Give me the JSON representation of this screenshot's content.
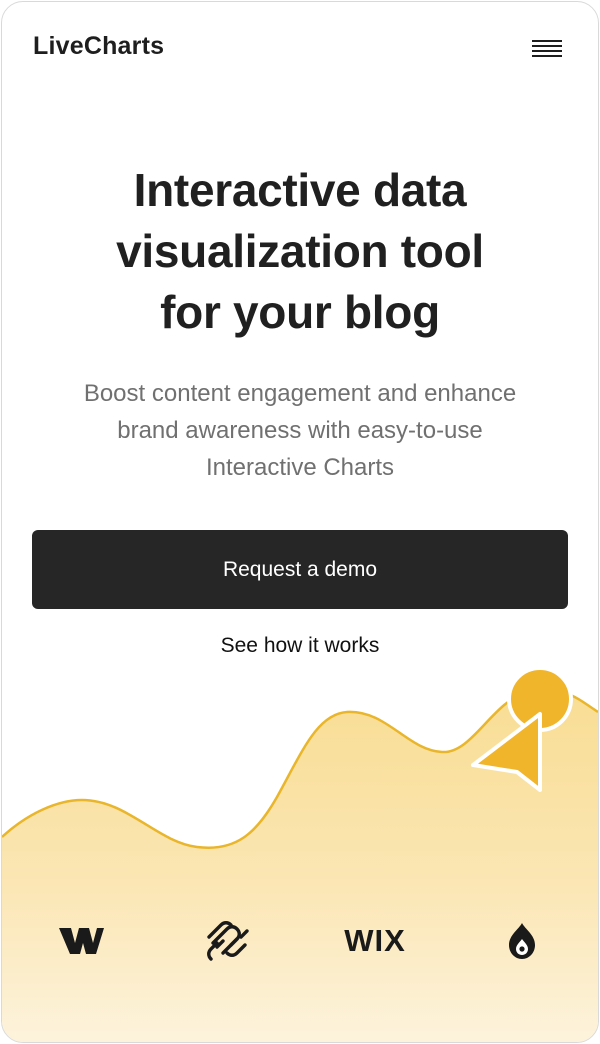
{
  "header": {
    "brand": "LiveCharts",
    "menu_icon": "hamburger-menu-icon"
  },
  "hero": {
    "title_lines": [
      "Interactive data",
      "visualization tool",
      "for your blog"
    ],
    "subtitle_lines": [
      "Boost content engagement and enhance",
      "brand awareness with easy-to-use",
      "Interactive Charts"
    ]
  },
  "actions": {
    "primary_label": "Request a demo",
    "secondary_label": "See how it works"
  },
  "illustration": {
    "fill_color": "#f7dd96",
    "line_color": "#e9b52a",
    "marker_color": "#f0b52b",
    "pointer_icon": "cursor-arrow-icon"
  },
  "integrations": [
    {
      "name": "webflow",
      "icon": "webflow-logo-icon"
    },
    {
      "name": "squarespace",
      "icon": "squarespace-logo-icon"
    },
    {
      "name": "wix",
      "icon": "wix-logo-icon",
      "text": "WIX"
    },
    {
      "name": "drupal",
      "icon": "drupal-logo-icon"
    }
  ]
}
